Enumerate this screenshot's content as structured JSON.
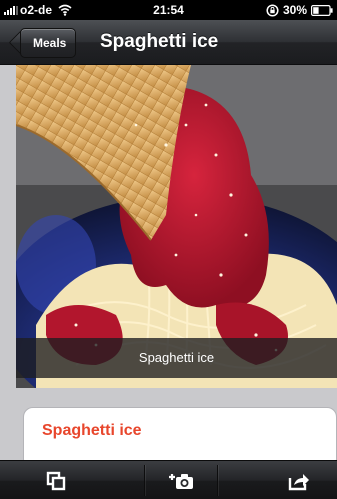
{
  "status_bar": {
    "carrier": "o2-de",
    "time": "21:54",
    "battery": "30%"
  },
  "nav": {
    "back_label": "Meals",
    "title": "Spaghetti ice"
  },
  "photo": {
    "caption": "Spaghetti ice"
  },
  "card": {
    "title": "Spaghetti ice"
  },
  "toolbar": {
    "items": [
      "copy-icon",
      "add-photo-icon",
      "share-icon"
    ]
  },
  "colors": {
    "accent": "#e8462c",
    "nav_dark": "#222326"
  }
}
